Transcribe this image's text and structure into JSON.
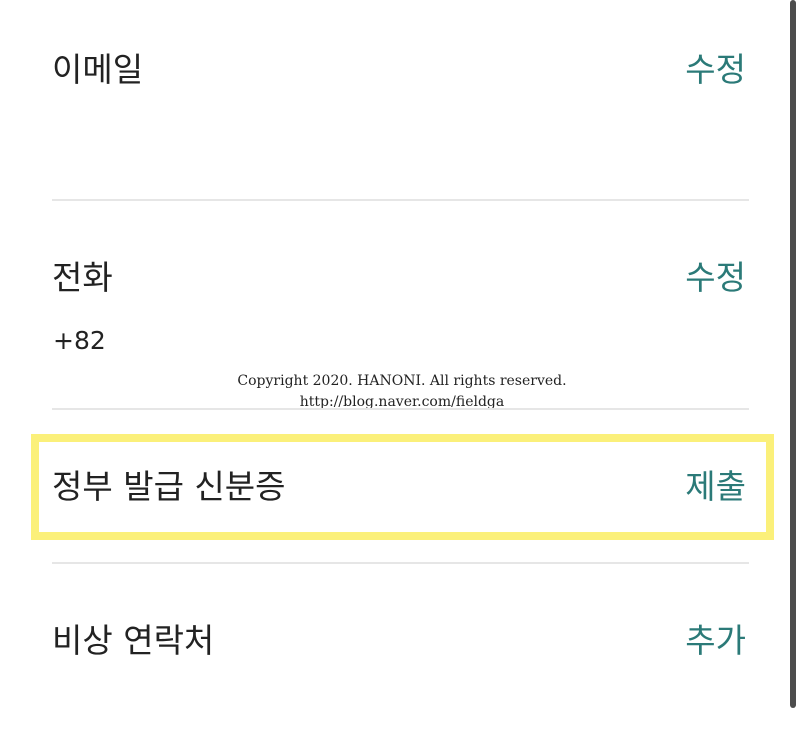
{
  "rows": [
    {
      "label": "이메일",
      "action": "수정",
      "value": ""
    },
    {
      "label": "전화",
      "action": "수정",
      "value": "+82"
    },
    {
      "label": "정부 발급 신분증",
      "action": "제출",
      "value": ""
    },
    {
      "label": "비상 연락처",
      "action": "추가",
      "value": ""
    }
  ],
  "watermark": {
    "line1": "Copyright 2020. HANONI. All rights reserved.",
    "line2": "http://blog.naver.com/fieldga"
  },
  "colors": {
    "accent": "#2b7a78",
    "highlight": "#fbf07a",
    "divider": "#e6e6e6",
    "text": "#222222"
  }
}
